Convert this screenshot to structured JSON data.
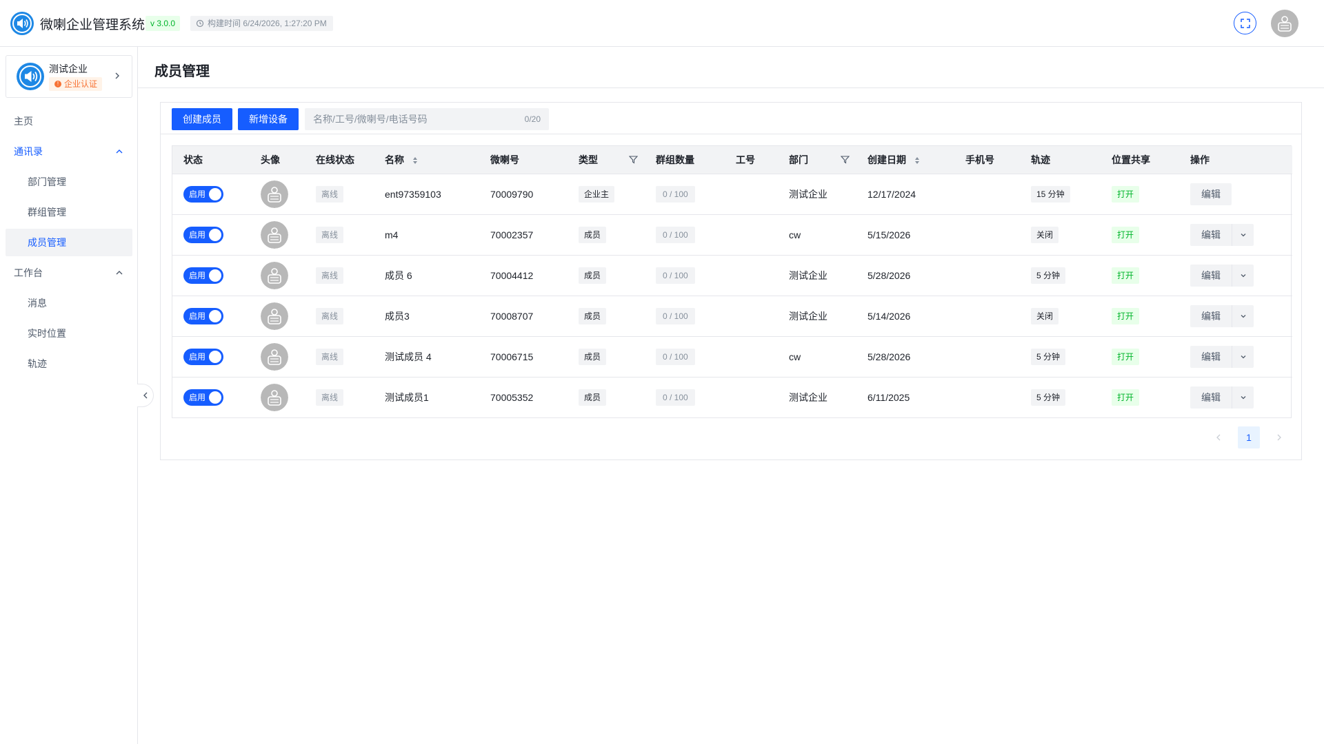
{
  "header": {
    "title": "微喇企业管理系统",
    "version": "v 3.0.0",
    "build_time": "构建时间 6/24/2026, 1:27:20 PM",
    "icons": [
      "speaker-logo-icon",
      "clock-icon",
      "fullscreen-icon",
      "user-avatar-icon"
    ]
  },
  "sidebar": {
    "org": {
      "name": "测试企业",
      "badge": "企业认证"
    },
    "menu": {
      "home": "主页",
      "contacts": "通讯录",
      "dept": "部门管理",
      "groups": "群组管理",
      "members": "成员管理",
      "workbench": "工作台",
      "messages": "消息",
      "location": "实时位置",
      "track": "轨迹"
    }
  },
  "page": {
    "title": "成员管理"
  },
  "toolbar": {
    "create_member": "创建成员",
    "add_device": "新增设备",
    "search_placeholder": "名称/工号/微喇号/电话号码",
    "search_count": "0/20"
  },
  "table": {
    "columns": {
      "status": "状态",
      "avatar": "头像",
      "online": "在线状态",
      "name": "名称",
      "weila_id": "微喇号",
      "type": "类型",
      "group_count": "群组数量",
      "job_no": "工号",
      "dept": "部门",
      "created": "创建日期",
      "phone": "手机号",
      "track": "轨迹",
      "share": "位置共享",
      "action": "操作"
    },
    "rows": [
      {
        "status": "启用",
        "online": "离线",
        "name": "ent97359103",
        "weila_id": "70009790",
        "type": "企业主",
        "groups": "0 / 100",
        "job_no": "",
        "dept": "测试企业",
        "created": "12/17/2024",
        "phone": "",
        "track": "15 分钟",
        "share": "打开",
        "edit": "编辑"
      },
      {
        "status": "启用",
        "online": "离线",
        "name": "m4",
        "weila_id": "70002357",
        "type": "成员",
        "groups": "0 / 100",
        "job_no": "",
        "dept": "cw",
        "created": "5/15/2026",
        "phone": "",
        "track": "关闭",
        "share": "打开",
        "edit": "编辑"
      },
      {
        "status": "启用",
        "online": "离线",
        "name": "成员 6",
        "weila_id": "70004412",
        "type": "成员",
        "groups": "0 / 100",
        "job_no": "",
        "dept": "测试企业",
        "created": "5/28/2026",
        "phone": "",
        "track": "5 分钟",
        "share": "打开",
        "edit": "编辑"
      },
      {
        "status": "启用",
        "online": "离线",
        "name": "成员3",
        "weila_id": "70008707",
        "type": "成员",
        "groups": "0 / 100",
        "job_no": "",
        "dept": "测试企业",
        "created": "5/14/2026",
        "phone": "",
        "track": "关闭",
        "share": "打开",
        "edit": "编辑"
      },
      {
        "status": "启用",
        "online": "离线",
        "name": "测试成员 4",
        "weila_id": "70006715",
        "type": "成员",
        "groups": "0 / 100",
        "job_no": "",
        "dept": "cw",
        "created": "5/28/2026",
        "phone": "",
        "track": "5 分钟",
        "share": "打开",
        "edit": "编辑"
      },
      {
        "status": "启用",
        "online": "离线",
        "name": "测试成员1",
        "weila_id": "70005352",
        "type": "成员",
        "groups": "0 / 100",
        "job_no": "",
        "dept": "测试企业",
        "created": "6/11/2025",
        "phone": "",
        "track": "5 分钟",
        "share": "打开",
        "edit": "编辑"
      }
    ]
  },
  "pagination": {
    "current": "1"
  },
  "colors": {
    "primary": "#165dff",
    "success": "#00b42a",
    "warning": "#f77234",
    "border": "#e5e6eb"
  }
}
